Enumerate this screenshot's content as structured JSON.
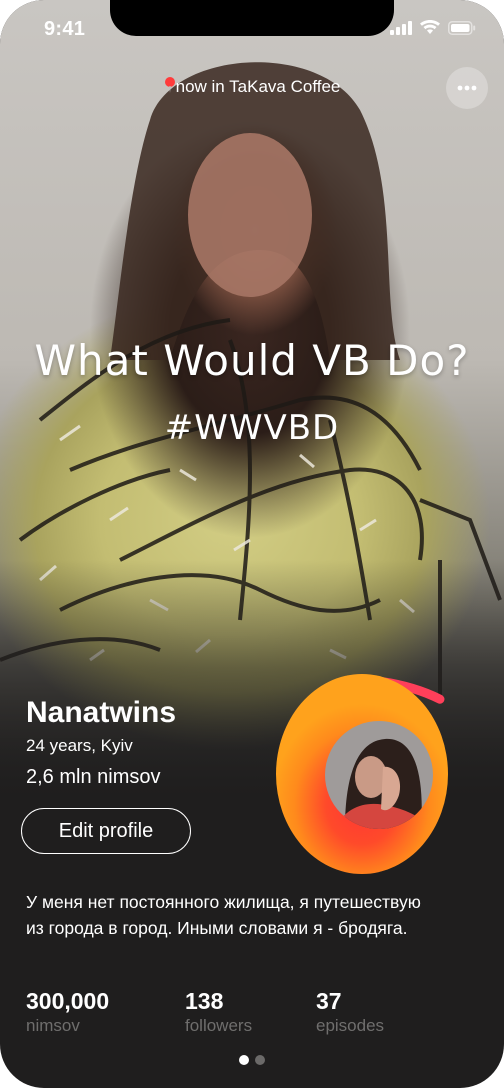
{
  "status_bar": {
    "time": "9:41"
  },
  "location": {
    "text": "now in TaKava Coffee",
    "pin_icon": "location-pin-icon"
  },
  "hero": {
    "title": "What Would VB Do?",
    "hashtag": "#WWVBD"
  },
  "profile": {
    "name": "Nanatwins",
    "age_city": "24 years, Kyiv",
    "nimsov_total": "2,6 mln nimsov",
    "edit_button": "Edit profile"
  },
  "bio": "У меня нет постоянного жилища, я путешествую из города в город. Иными словами я - бродяга.",
  "stats": [
    {
      "value": "300,000",
      "label": "nimsov"
    },
    {
      "value": "138",
      "label": "followers"
    },
    {
      "value": "37",
      "label": "episodes"
    }
  ],
  "pager": {
    "count": 2,
    "active": 1
  },
  "colors": {
    "background": "#1f1e1e",
    "accent_orange": "#ffa21c",
    "accent_red": "#ff3535",
    "muted_text": "#6f6e6d"
  }
}
